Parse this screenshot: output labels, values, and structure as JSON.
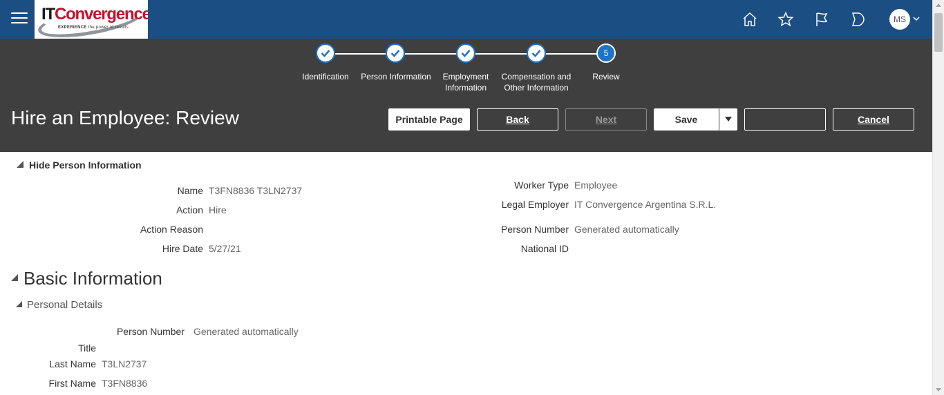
{
  "topbar": {
    "logo": {
      "brand_it": "IT",
      "brand_rest": "Convergence",
      "tagline_bold": "EXPERIENCE",
      "tagline_rest": " the power of results"
    },
    "icons": [
      "menu-icon",
      "home-icon",
      "star-icon",
      "flag-icon",
      "notification-icon"
    ],
    "user_initials": "MS",
    "bar_color": "#1b4f83"
  },
  "train": {
    "steps": [
      {
        "label": "Identification",
        "status": "done"
      },
      {
        "label": "Person Information",
        "status": "done"
      },
      {
        "label": "Employment Information",
        "status": "done"
      },
      {
        "label": "Compensation and Other Information",
        "status": "done"
      },
      {
        "label": "Review",
        "number": "5",
        "status": "current"
      }
    ],
    "accent": "#1e74c6"
  },
  "header": {
    "title": "Hire an Employee: Review",
    "buttons": {
      "printable": "Printable Page",
      "back": "Back",
      "next": "Next",
      "save": "Save",
      "blank": "",
      "cancel": "Cancel"
    }
  },
  "person_info": {
    "toggle_label": "Hide Person Information",
    "left": [
      {
        "label": "Name",
        "value": "T3FN8836 T3LN2737"
      },
      {
        "label": "Action",
        "value": "Hire"
      },
      {
        "label": "Action Reason",
        "value": ""
      },
      {
        "label": "Hire Date",
        "value": "5/27/21"
      }
    ],
    "right": [
      {
        "label": "Worker Type",
        "value": "Employee"
      },
      {
        "label": "Legal Employer",
        "value": "IT Convergence Argentina S.R.L."
      },
      {
        "label": "Person Number",
        "value": "Generated automatically"
      },
      {
        "label": "National ID",
        "value": ""
      }
    ]
  },
  "basic_info": {
    "heading": "Basic Information",
    "subheading": "Personal Details",
    "fields": [
      {
        "label": "Person Number",
        "value": "Generated automatically"
      },
      {
        "label": "Title",
        "value": ""
      },
      {
        "label": "Last Name",
        "value": "T3LN2737"
      },
      {
        "label": "First Name",
        "value": "T3FN8836"
      }
    ]
  }
}
